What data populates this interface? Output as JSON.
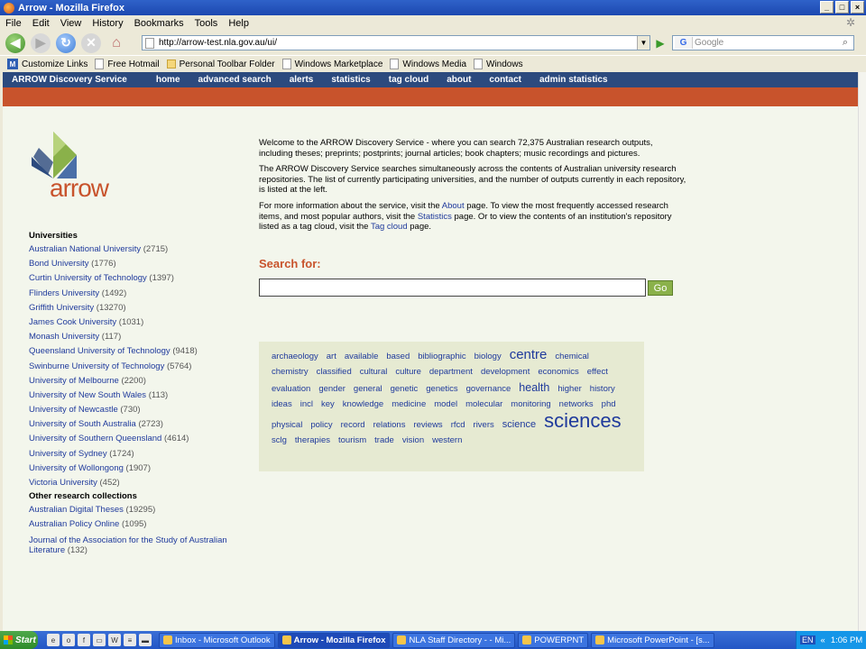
{
  "window": {
    "title": "Arrow - Mozilla Firefox",
    "buttons": [
      "_",
      "□",
      "×"
    ]
  },
  "menu": [
    "File",
    "Edit",
    "View",
    "History",
    "Bookmarks",
    "Tools",
    "Help"
  ],
  "navbar": {
    "url": "http://arrow-test.nla.gov.au/ui/",
    "search_placeholder": "Google",
    "search_engine": "G"
  },
  "bookmarks": [
    {
      "label": "Customize Links",
      "icon": "m"
    },
    {
      "label": "Free Hotmail",
      "icon": "page"
    },
    {
      "label": "Personal Toolbar Folder",
      "icon": "folder"
    },
    {
      "label": "Windows Marketplace",
      "icon": "page"
    },
    {
      "label": "Windows Media",
      "icon": "page"
    },
    {
      "label": "Windows",
      "icon": "page"
    }
  ],
  "site": {
    "brand": "ARROW Discovery Service",
    "nav": [
      "home",
      "advanced search",
      "alerts",
      "statistics",
      "tag cloud",
      "about",
      "contact",
      "admin statistics"
    ],
    "logo_text": "arrow",
    "colors": {
      "nav": "#2c4a7e",
      "accent": "#c8532c",
      "link": "#1f3a9c",
      "go": "#8ab14a"
    }
  },
  "sidebar": {
    "universities_heading": "Universities",
    "universities": [
      {
        "name": "Australian National University",
        "count": "(2715)"
      },
      {
        "name": "Bond University",
        "count": "(1776)"
      },
      {
        "name": "Curtin University of Technology",
        "count": "(1397)"
      },
      {
        "name": "Flinders University",
        "count": "(1492)"
      },
      {
        "name": "Griffith University",
        "count": "(13270)"
      },
      {
        "name": "James Cook University",
        "count": "(1031)"
      },
      {
        "name": "Monash University",
        "count": "(117)"
      },
      {
        "name": "Queensland University of Technology",
        "count": "(9418)"
      },
      {
        "name": "Swinburne University of Technology",
        "count": "(5764)"
      },
      {
        "name": "University of Melbourne",
        "count": "(2200)"
      },
      {
        "name": "University of New South Wales",
        "count": "(113)"
      },
      {
        "name": "University of Newcastle",
        "count": "(730)"
      },
      {
        "name": "University of South Australia",
        "count": "(2723)"
      },
      {
        "name": "University of Southern Queensland",
        "count": "(4614)"
      },
      {
        "name": "University of Sydney",
        "count": "(1724)"
      },
      {
        "name": "University of Wollongong",
        "count": "(1907)"
      },
      {
        "name": "Victoria University",
        "count": "(452)"
      }
    ],
    "other_heading": "Other research collections",
    "other": [
      {
        "name": "Australian Digital Theses",
        "count": "(19295)"
      },
      {
        "name": "Australian Policy Online",
        "count": "(1095)"
      },
      {
        "name": "Journal of the Association for the Study of Australian Literature",
        "count": "(132)"
      }
    ]
  },
  "intro": {
    "p1": "Welcome to the ARROW Discovery Service - where you can search 72,375 Australian research outputs, including theses; preprints; postprints; journal articles; book chapters; music recordings and pictures.",
    "p2": "The ARROW Discovery Service searches simultaneously across the contents of Australian university research repositories. The list of currently participating universities, and the number of outputs currently in each repository, is listed at the left.",
    "p3_a": "For more information about the service, visit the ",
    "p3_about": "About",
    "p3_b": " page. To view the most frequently accessed research items, and most popular authors, visit the ",
    "p3_stats": "Statistics",
    "p3_c": " page. Or to view the contents of an institution's repository listed as a tag cloud, visit the ",
    "p3_tag": "Tag cloud",
    "p3_d": " page."
  },
  "search": {
    "label": "Search for:",
    "value": "",
    "go": "Go"
  },
  "tags": [
    {
      "t": "archaeology",
      "s": 1
    },
    {
      "t": "art",
      "s": 1
    },
    {
      "t": "available",
      "s": 1
    },
    {
      "t": "based",
      "s": 1
    },
    {
      "t": "bibliographic",
      "s": 1
    },
    {
      "t": "biology",
      "s": 1
    },
    {
      "t": "centre",
      "s": 4
    },
    {
      "t": "chemical",
      "s": 1
    },
    {
      "t": "chemistry",
      "s": 1
    },
    {
      "t": "classified",
      "s": 1
    },
    {
      "t": "cultural",
      "s": 1
    },
    {
      "t": "culture",
      "s": 1
    },
    {
      "t": "department",
      "s": 1
    },
    {
      "t": "development",
      "s": 1
    },
    {
      "t": "economics",
      "s": 1
    },
    {
      "t": "effect",
      "s": 1
    },
    {
      "t": "evaluation",
      "s": 1
    },
    {
      "t": "gender",
      "s": 1
    },
    {
      "t": "general",
      "s": 1
    },
    {
      "t": "genetic",
      "s": 1
    },
    {
      "t": "genetics",
      "s": 1
    },
    {
      "t": "governance",
      "s": 1
    },
    {
      "t": "health",
      "s": 3
    },
    {
      "t": "higher",
      "s": 1
    },
    {
      "t": "history",
      "s": 1
    },
    {
      "t": "ideas",
      "s": 1
    },
    {
      "t": "incl",
      "s": 1
    },
    {
      "t": "key",
      "s": 1
    },
    {
      "t": "knowledge",
      "s": 1
    },
    {
      "t": "medicine",
      "s": 1
    },
    {
      "t": "model",
      "s": 1
    },
    {
      "t": "molecular",
      "s": 1
    },
    {
      "t": "monitoring",
      "s": 1
    },
    {
      "t": "networks",
      "s": 1
    },
    {
      "t": "phd",
      "s": 1
    },
    {
      "t": "physical",
      "s": 1
    },
    {
      "t": "policy",
      "s": 1
    },
    {
      "t": "record",
      "s": 1
    },
    {
      "t": "relations",
      "s": 1
    },
    {
      "t": "reviews",
      "s": 1
    },
    {
      "t": "rfcd",
      "s": 1
    },
    {
      "t": "rivers",
      "s": 1
    },
    {
      "t": "science",
      "s": 2
    },
    {
      "t": "sciences",
      "s": 5
    },
    {
      "t": "sclg",
      "s": 1
    },
    {
      "t": "therapies",
      "s": 1
    },
    {
      "t": "tourism",
      "s": 1
    },
    {
      "t": "trade",
      "s": 1
    },
    {
      "t": "vision",
      "s": 1
    },
    {
      "t": "western",
      "s": 1
    }
  ],
  "taskbar": {
    "start": "Start",
    "tasks": [
      {
        "label": "Inbox - Microsoft Outlook",
        "active": false
      },
      {
        "label": "Arrow - Mozilla Firefox",
        "active": true
      },
      {
        "label": "NLA Staff Directory - - Mi...",
        "active": false
      },
      {
        "label": "POWERPNT",
        "active": false
      },
      {
        "label": "Microsoft PowerPoint - [s...",
        "active": false
      }
    ],
    "lang": "EN",
    "time": "1:06 PM"
  }
}
